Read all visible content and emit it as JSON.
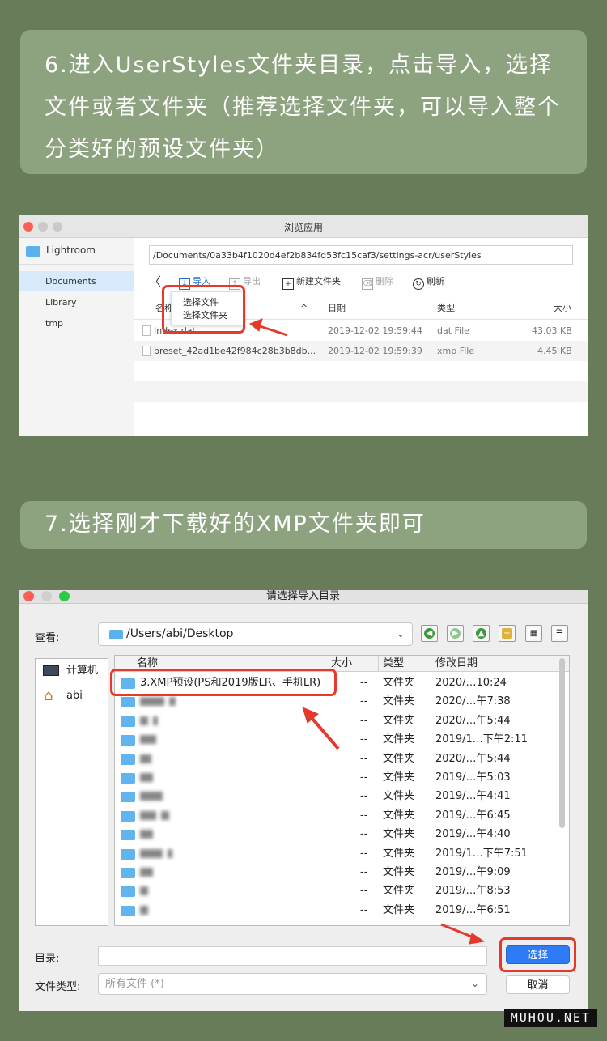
{
  "step6": {
    "text": "6.进入UserStyles文件夹目录，点击导入，选择文件或者文件夹（推荐选择文件夹，可以导入整个分类好的预设文件夹）"
  },
  "step7": {
    "text": "7.选择刚才下载好的XMP文件夹即可"
  },
  "window1": {
    "title": "浏览应用",
    "sidebar": {
      "root": "Lightroom",
      "items": [
        "Documents",
        "Library",
        "tmp"
      ],
      "selected": "Documents"
    },
    "path": "/Documents/0a33b4f1020d4ef2b834fd53fc15caf3/settings-acr/userStyles",
    "toolbar": {
      "back": "〈",
      "import": "导入",
      "export": "导出",
      "new_folder": "新建文件夹",
      "delete": "删除",
      "refresh": "刷新"
    },
    "columns": {
      "name": "名称",
      "sort": "^",
      "date": "日期",
      "type": "类型",
      "size": "大小"
    },
    "files": [
      {
        "name": "Index.dat",
        "date": "2019-12-02 19:59:44",
        "type": "dat File",
        "size": "43.03 KB"
      },
      {
        "name": "preset_42ad1be42f984c28b3b8db...",
        "date": "2019-12-02 19:59:39",
        "type": "xmp File",
        "size": "4.45 KB"
      }
    ],
    "popup": {
      "choose_file": "选择文件",
      "choose_folder": "选择文件夹"
    }
  },
  "window2": {
    "title": "请选择导入目录",
    "look_in_label": "查看:",
    "look_in_value": "/Users/abi/Desktop",
    "places": [
      {
        "label": "计算机",
        "icon": "computer-icon"
      },
      {
        "label": "abi",
        "icon": "home-icon"
      }
    ],
    "columns": {
      "name": "名称",
      "size": "大小",
      "type": "类型",
      "modified": "修改日期"
    },
    "rows": [
      {
        "name": "3.XMP预设(PS和2019版LR、手机LR)",
        "size": "--",
        "type": "文件夹",
        "date": "2020/…10:24"
      },
      {
        "name": "",
        "size": "--",
        "type": "文件夹",
        "date": "2020/…午7:38"
      },
      {
        "name": "",
        "size": "--",
        "type": "文件夹",
        "date": "2020/…午5:44"
      },
      {
        "name": "",
        "size": "--",
        "type": "文件夹",
        "date": "2019/1…下午2:11"
      },
      {
        "name": "",
        "size": "--",
        "type": "文件夹",
        "date": "2020/…午5:44"
      },
      {
        "name": "",
        "size": "--",
        "type": "文件夹",
        "date": "2019/…午5:03"
      },
      {
        "name": "",
        "size": "--",
        "type": "文件夹",
        "date": "2019/…午4:41"
      },
      {
        "name": "",
        "size": "--",
        "type": "文件夹",
        "date": "2019/…午6:45"
      },
      {
        "name": "",
        "size": "--",
        "type": "文件夹",
        "date": "2019/…午4:40"
      },
      {
        "name": "",
        "size": "--",
        "type": "文件夹",
        "date": "2019/1…下午7:51"
      },
      {
        "name": "",
        "size": "--",
        "type": "文件夹",
        "date": "2019/…午9:09"
      },
      {
        "name": "",
        "size": "--",
        "type": "文件夹",
        "date": "2019/…午8:53"
      },
      {
        "name": "",
        "size": "--",
        "type": "文件夹",
        "date": "2019/…午6:51"
      }
    ],
    "dir_label": "目录:",
    "dir_value": "",
    "filetype_label": "文件类型:",
    "filetype_value": "所有文件 (*)",
    "choose_button": "选择",
    "cancel_button": "取消"
  },
  "watermark": "MUHOU.NET",
  "colors": {
    "background": "#687c5a",
    "banner": "#8da27e",
    "highlight": "#e53a2b",
    "primary": "#2f7af5"
  }
}
